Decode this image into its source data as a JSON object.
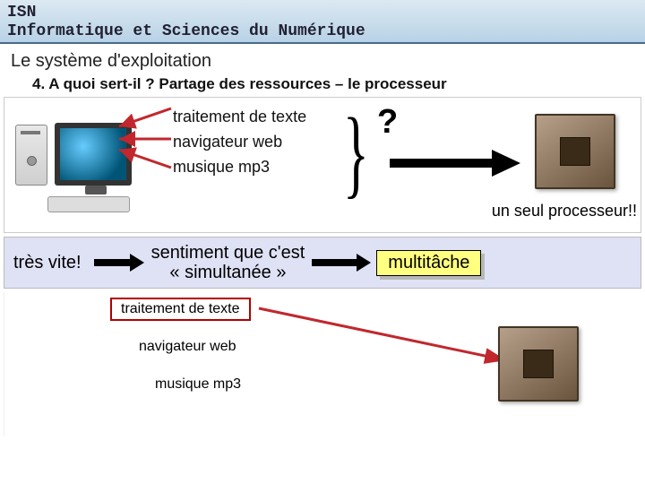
{
  "header": {
    "line1": "ISN",
    "line2": "Informatique et Sciences du Numérique"
  },
  "subtitle": "Le système d'exploitation",
  "question": "4.   A quoi sert-il ? Partage des ressources – le processeur",
  "apps": {
    "a1": "traitement de texte",
    "a2": "navigateur web",
    "a3": "musique mp3"
  },
  "qmark": "?",
  "caption_processor": "un seul processeur!!",
  "band": {
    "fast": "très vite!",
    "mid_l1": "sentiment que c'est",
    "mid_l2": "« simultanée »",
    "multitask": "multitâche"
  },
  "apps2": {
    "a1": "traitement de texte",
    "a2": "navigateur web",
    "a3": "musique mp3"
  }
}
